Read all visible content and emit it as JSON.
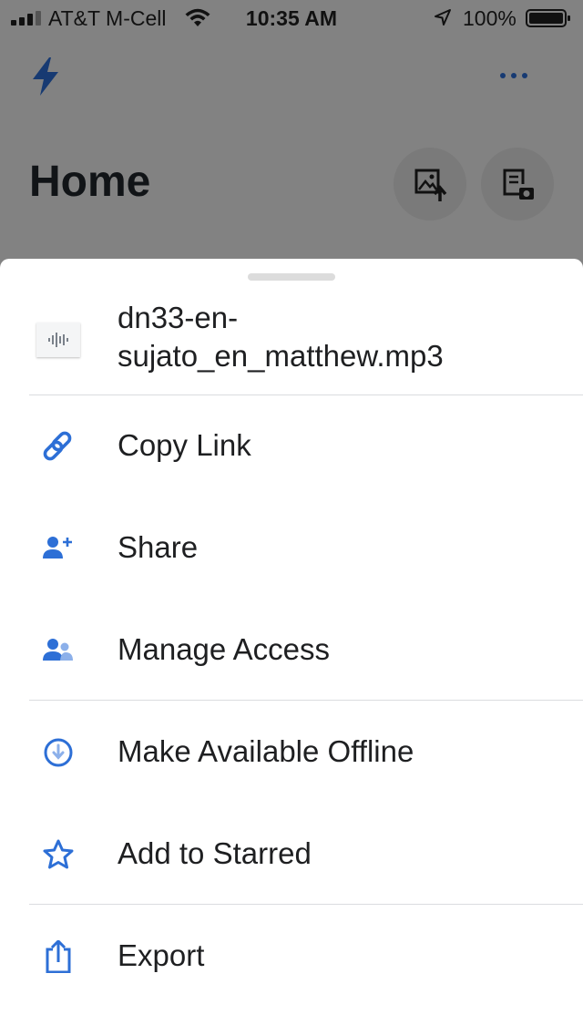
{
  "status_bar": {
    "carrier": "AT&T M-Cell",
    "time": "10:35 AM",
    "battery": "100%"
  },
  "page": {
    "title": "Home"
  },
  "icons": {
    "logo": "bolt-icon",
    "more": "more-dots-icon",
    "upload_photo": "upload-photo-icon",
    "scan_doc": "scan-document-icon"
  },
  "sheet": {
    "file_name": "dn33-en-sujato_en_matthew.mp3",
    "file_icon": "audio-waveform-icon",
    "menu": [
      {
        "label": "Copy Link",
        "icon": "link-icon"
      },
      {
        "label": "Share",
        "icon": "share-person-plus-icon"
      },
      {
        "label": "Manage Access",
        "icon": "people-icon"
      },
      {
        "label": "Make Available Offline",
        "icon": "download-circle-icon"
      },
      {
        "label": "Add to Starred",
        "icon": "star-icon"
      },
      {
        "label": "Export",
        "icon": "export-icon"
      }
    ]
  },
  "colors": {
    "accent": "#2d6fd6",
    "backdrop": "#828282",
    "sheet": "#ffffff",
    "text": "#1e1f21"
  }
}
